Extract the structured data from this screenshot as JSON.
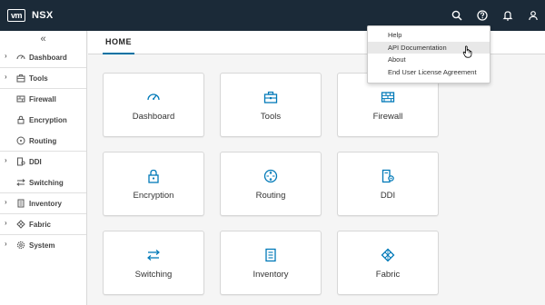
{
  "header": {
    "logo_text": "vm",
    "app_title": "NSX",
    "icons": [
      "search-icon",
      "help-icon",
      "bell-icon",
      "user-icon"
    ]
  },
  "sidebar": {
    "collapse_glyph": "«",
    "items": [
      {
        "label": "Dashboard",
        "expandable": true,
        "icon": "dashboard-icon"
      },
      {
        "label": "Tools",
        "expandable": true,
        "icon": "toolbox-icon"
      },
      {
        "label": "Firewall",
        "expandable": false,
        "icon": "firewall-icon"
      },
      {
        "label": "Encryption",
        "expandable": false,
        "icon": "lock-icon"
      },
      {
        "label": "Routing",
        "expandable": false,
        "icon": "routing-icon"
      },
      {
        "label": "DDI",
        "expandable": true,
        "icon": "ddi-icon"
      },
      {
        "label": "Switching",
        "expandable": false,
        "icon": "switching-icon"
      },
      {
        "label": "Inventory",
        "expandable": true,
        "icon": "inventory-icon"
      },
      {
        "label": "Fabric",
        "expandable": true,
        "icon": "fabric-icon"
      },
      {
        "label": "System",
        "expandable": true,
        "icon": "system-icon"
      }
    ]
  },
  "main": {
    "tab": "HOME",
    "cards": [
      {
        "label": "Dashboard",
        "icon": "dashboard-icon"
      },
      {
        "label": "Tools",
        "icon": "toolbox-icon"
      },
      {
        "label": "Firewall",
        "icon": "firewall-icon"
      },
      {
        "label": "Encryption",
        "icon": "lock-icon"
      },
      {
        "label": "Routing",
        "icon": "routing-icon"
      },
      {
        "label": "DDI",
        "icon": "ddi-icon"
      },
      {
        "label": "Switching",
        "icon": "switching-icon"
      },
      {
        "label": "Inventory",
        "icon": "inventory-icon"
      },
      {
        "label": "Fabric",
        "icon": "fabric-icon"
      }
    ]
  },
  "help_menu": {
    "items": [
      "Help",
      "API Documentation",
      "About",
      "End User License Agreement"
    ],
    "hovered": "API Documentation"
  },
  "colors": {
    "header_bg": "#1b2a38",
    "accent": "#0072a3",
    "icon_blue": "#0079b8"
  }
}
